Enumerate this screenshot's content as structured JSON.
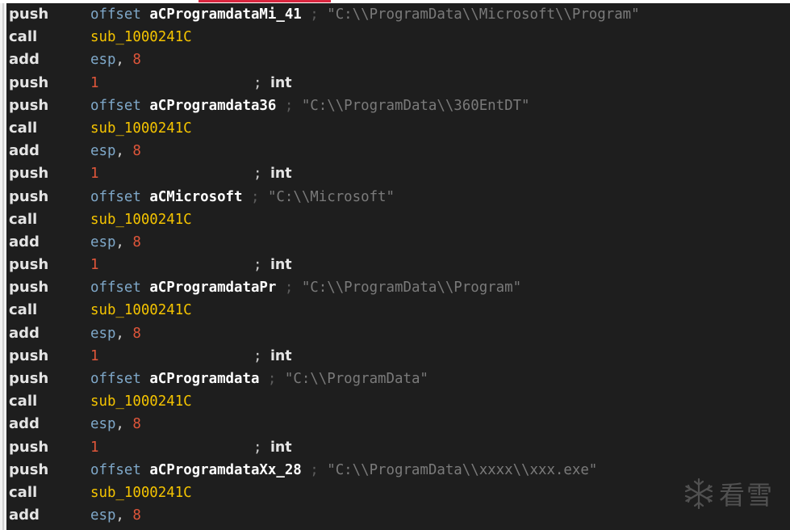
{
  "watermark": {
    "text": "看雪",
    "icon": "snowflake-icon"
  },
  "lines": [
    {
      "mnemonic": "push",
      "kind": "offset",
      "keyword": "offset",
      "label": "aCProgramdataMi_41",
      "sep": ";",
      "comment": "\"C:\\\\ProgramData\\\\Microsoft\\\\Program\""
    },
    {
      "mnemonic": "call",
      "kind": "call",
      "target": "sub_1000241C"
    },
    {
      "mnemonic": "add",
      "kind": "add",
      "reg": "esp",
      "comma": ",",
      "value": "8"
    },
    {
      "mnemonic": "push",
      "kind": "imm",
      "value": "1",
      "sep": ";",
      "type": "int"
    },
    {
      "mnemonic": "push",
      "kind": "offset",
      "keyword": "offset",
      "label": "aCProgramdata36",
      "sep": ";",
      "comment": "\"C:\\\\ProgramData\\\\360EntDT\""
    },
    {
      "mnemonic": "call",
      "kind": "call",
      "target": "sub_1000241C"
    },
    {
      "mnemonic": "add",
      "kind": "add",
      "reg": "esp",
      "comma": ",",
      "value": "8"
    },
    {
      "mnemonic": "push",
      "kind": "imm",
      "value": "1",
      "sep": ";",
      "type": "int"
    },
    {
      "mnemonic": "push",
      "kind": "offset",
      "keyword": "offset",
      "label": "aCMicrosoft",
      "sep": ";",
      "comment": "\"C:\\\\Microsoft\""
    },
    {
      "mnemonic": "call",
      "kind": "call",
      "target": "sub_1000241C"
    },
    {
      "mnemonic": "add",
      "kind": "add",
      "reg": "esp",
      "comma": ",",
      "value": "8"
    },
    {
      "mnemonic": "push",
      "kind": "imm",
      "value": "1",
      "sep": ";",
      "type": "int"
    },
    {
      "mnemonic": "push",
      "kind": "offset",
      "keyword": "offset",
      "label": "aCProgramdataPr",
      "sep": ";",
      "comment": "\"C:\\\\ProgramData\\\\Program\""
    },
    {
      "mnemonic": "call",
      "kind": "call",
      "target": "sub_1000241C"
    },
    {
      "mnemonic": "add",
      "kind": "add",
      "reg": "esp",
      "comma": ",",
      "value": "8"
    },
    {
      "mnemonic": "push",
      "kind": "imm",
      "value": "1",
      "sep": ";",
      "type": "int"
    },
    {
      "mnemonic": "push",
      "kind": "offset",
      "keyword": "offset",
      "label": "aCProgramdata",
      "sep": ";",
      "comment": "\"C:\\\\ProgramData\""
    },
    {
      "mnemonic": "call",
      "kind": "call",
      "target": "sub_1000241C"
    },
    {
      "mnemonic": "add",
      "kind": "add",
      "reg": "esp",
      "comma": ",",
      "value": "8"
    },
    {
      "mnemonic": "push",
      "kind": "imm",
      "value": "1",
      "sep": ";",
      "type": "int"
    },
    {
      "mnemonic": "push",
      "kind": "offset",
      "keyword": "offset",
      "label": "aCProgramdataXx_28",
      "sep": ";",
      "comment": "\"C:\\\\ProgramData\\\\xxxx\\\\xxx.exe\""
    },
    {
      "mnemonic": "call",
      "kind": "call",
      "target": "sub_1000241C"
    },
    {
      "mnemonic": "add",
      "kind": "add",
      "reg": "esp",
      "comma": ",",
      "value": "8"
    }
  ]
}
